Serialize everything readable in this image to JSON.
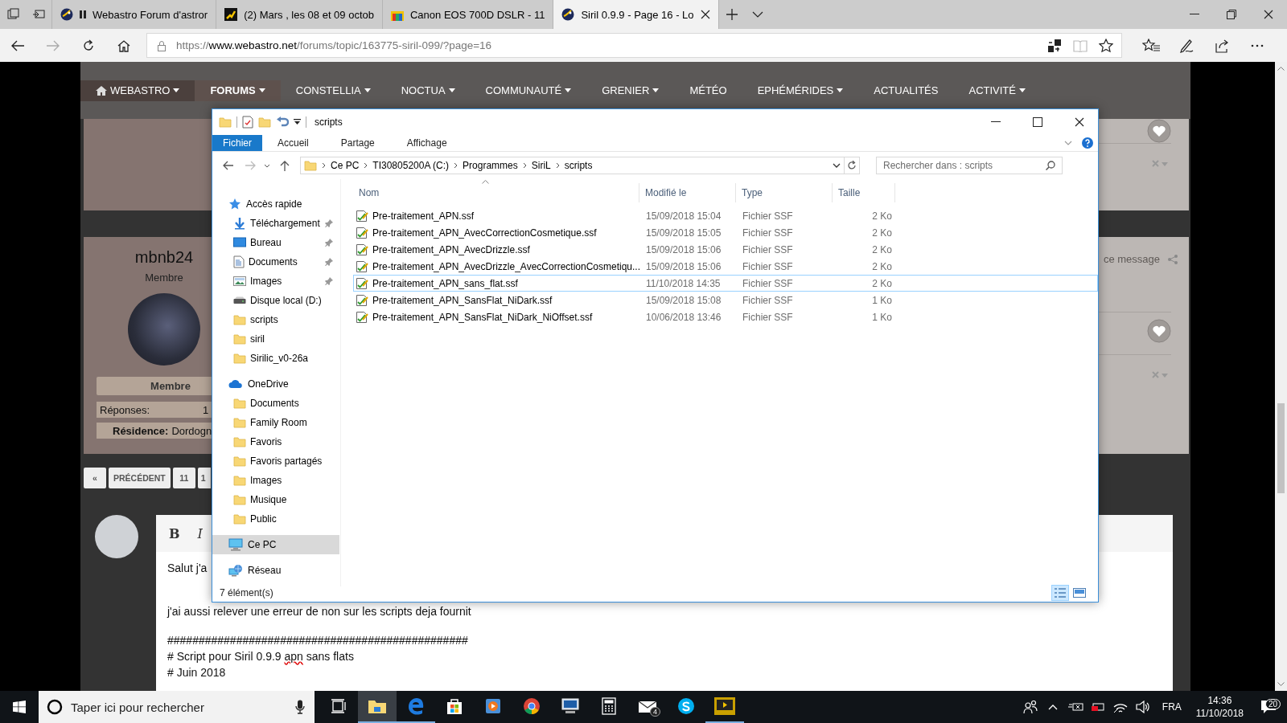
{
  "browser": {
    "tabs": [
      {
        "title": "Webastro Forum d'astror",
        "kind": "astro",
        "media_paused": true,
        "selected": false
      },
      {
        "title": "(2) Mars , les 08 et 09 octob",
        "kind": "runner",
        "media_paused": false,
        "selected": false
      },
      {
        "title": "Canon EOS 700D DSLR - 11",
        "kind": "store",
        "media_paused": false,
        "selected": false
      },
      {
        "title": "Siril 0.9.9 - Page 16 - Lo",
        "kind": "astro",
        "media_paused": false,
        "selected": true
      }
    ],
    "url": {
      "scheme": "https://",
      "host": "www.webastro.net",
      "path": "/forums/topic/163775-siril-099/?page=16"
    }
  },
  "site": {
    "nav": [
      {
        "label": "WEBASTRO",
        "home": true,
        "menu": true,
        "selected": false
      },
      {
        "label": "FORUMS",
        "home": false,
        "menu": true,
        "selected": true
      },
      {
        "label": "CONSTELLIA",
        "home": false,
        "menu": true,
        "selected": false
      },
      {
        "label": "NOCTUA",
        "home": false,
        "menu": true,
        "selected": false
      },
      {
        "label": "COMMUNAUTÉ",
        "home": false,
        "menu": true,
        "selected": false
      },
      {
        "label": "GRENIER",
        "home": false,
        "menu": true,
        "selected": false
      },
      {
        "label": "MÉTÉO",
        "home": false,
        "menu": false,
        "selected": false
      },
      {
        "label": "EPHÉMÉRIDES",
        "home": false,
        "menu": true,
        "selected": false
      },
      {
        "label": "ACTUALITÉS",
        "home": false,
        "menu": false,
        "selected": false
      },
      {
        "label": "ACTIVITÉ",
        "home": false,
        "menu": true,
        "selected": false
      }
    ],
    "post": {
      "author": "mbnb24",
      "rank": "Membre",
      "group": "Membre",
      "replies_label": "Réponses:",
      "replies": "1",
      "residence_label": "Résidence:",
      "residence": "Dordogn",
      "share_text": "ce message"
    },
    "pagination": [
      {
        "label": "«"
      },
      {
        "label": "PRÉCÉDENT"
      },
      {
        "label": "11"
      },
      {
        "label": "1"
      }
    ],
    "editor": {
      "toolbar": [
        {
          "label": "B",
          "kind": "bold"
        },
        {
          "label": "I",
          "kind": "italic"
        }
      ],
      "paragraphs": [
        [
          [
            {
              "text": "Salut j'a",
              "misspelled": false
            }
          ]
        ],
        [
          [
            {
              "text": "j'ai aussi relever une erreur de non sur les scripts deja fournit",
              "misspelled": false
            }
          ]
        ],
        [
          [
            {
              "text": "################################################",
              "misspelled": false
            }
          ],
          [
            {
              "text": "# Script pour Siril 0.9.9 ",
              "misspelled": false
            },
            {
              "text": "apn",
              "misspelled": true
            },
            {
              "text": " sans flats",
              "misspelled": false
            }
          ],
          [
            {
              "text": "# Juin 2018",
              "misspelled": false
            }
          ]
        ]
      ]
    }
  },
  "explorer": {
    "title": "scripts",
    "ribbon_tabs": [
      {
        "label": "Fichier",
        "selected": true
      },
      {
        "label": "Accueil",
        "selected": false
      },
      {
        "label": "Partage",
        "selected": false
      },
      {
        "label": "Affichage",
        "selected": false
      }
    ],
    "breadcrumb": [
      "Ce PC",
      "TI30805200A (C:)",
      "Programmes",
      "SiriL",
      "scripts"
    ],
    "search_placeholder": "Rechercher dans : scripts",
    "tree": [
      {
        "label": "Accès rapide",
        "kind": "star",
        "selected": false,
        "children": [
          {
            "label": "Téléchargement",
            "kind": "download",
            "pinned": true,
            "selected": false
          },
          {
            "label": "Bureau",
            "kind": "desktop",
            "pinned": true,
            "selected": false
          },
          {
            "label": "Documents",
            "kind": "documents",
            "pinned": true,
            "selected": false
          },
          {
            "label": "Images",
            "kind": "pictures",
            "pinned": true,
            "selected": false
          },
          {
            "label": "Disque local (D:)",
            "kind": "drive",
            "pinned": false,
            "selected": false
          },
          {
            "label": "scripts",
            "kind": "folder",
            "pinned": false,
            "selected": false
          },
          {
            "label": "siril",
            "kind": "folder",
            "pinned": false,
            "selected": false
          },
          {
            "label": "Sirilic_v0-26a",
            "kind": "folder",
            "pinned": false,
            "selected": false
          }
        ]
      },
      {
        "label": "OneDrive",
        "kind": "cloud",
        "selected": false,
        "children": [
          {
            "label": "Documents",
            "kind": "folder",
            "selected": false
          },
          {
            "label": "Family Room",
            "kind": "folder",
            "selected": false
          },
          {
            "label": "Favoris",
            "kind": "folder",
            "selected": false
          },
          {
            "label": "Favoris partagés",
            "kind": "folder",
            "selected": false
          },
          {
            "label": "Images",
            "kind": "folder",
            "selected": false
          },
          {
            "label": "Musique",
            "kind": "folder",
            "selected": false
          },
          {
            "label": "Public",
            "kind": "folder",
            "selected": false
          }
        ]
      },
      {
        "label": "Ce PC",
        "kind": "pc",
        "selected": true
      },
      {
        "label": "Réseau",
        "kind": "network",
        "selected": false
      }
    ],
    "columns": [
      "Nom",
      "Modifié le",
      "Type",
      "Taille"
    ],
    "files": [
      {
        "name": "Pre-traitement_APN.ssf",
        "modified": "15/09/2018 15:04",
        "type": "Fichier SSF",
        "size": "2 Ko",
        "selected": false
      },
      {
        "name": "Pre-traitement_APN_AvecCorrectionCosmetique.ssf",
        "modified": "15/09/2018 15:05",
        "type": "Fichier SSF",
        "size": "2 Ko",
        "selected": false
      },
      {
        "name": "Pre-traitement_APN_AvecDrizzle.ssf",
        "modified": "15/09/2018 15:06",
        "type": "Fichier SSF",
        "size": "2 Ko",
        "selected": false
      },
      {
        "name": "Pre-traitement_APN_AvecDrizzle_AvecCorrectionCosmetiqu...",
        "modified": "15/09/2018 15:06",
        "type": "Fichier SSF",
        "size": "2 Ko",
        "selected": false
      },
      {
        "name": "Pre-traitement_APN_sans_flat.ssf",
        "modified": "11/10/2018 14:35",
        "type": "Fichier SSF",
        "size": "2 Ko",
        "selected": true
      },
      {
        "name": "Pre-traitement_APN_SansFlat_NiDark.ssf",
        "modified": "15/09/2018 15:08",
        "type": "Fichier SSF",
        "size": "1 Ko",
        "selected": false
      },
      {
        "name": "Pre-traitement_APN_SansFlat_NiDark_NiOffset.ssf",
        "modified": "10/06/2018 13:46",
        "type": "Fichier SSF",
        "size": "1 Ko",
        "selected": false
      }
    ],
    "status": "7 élément(s)",
    "views": [
      {
        "kind": "details",
        "selected": true
      },
      {
        "kind": "large-icons",
        "selected": false
      }
    ]
  },
  "taskbar": {
    "search_placeholder": "Taper ici pour rechercher",
    "apps": [
      {
        "kind": "task-view",
        "open": false,
        "focused": false
      },
      {
        "kind": "folder",
        "open": true,
        "focused": true
      },
      {
        "kind": "edge",
        "open": true,
        "focused": false
      },
      {
        "kind": "store",
        "open": false,
        "focused": false
      },
      {
        "kind": "media",
        "open": false,
        "focused": false
      },
      {
        "kind": "chrome",
        "open": false,
        "focused": false
      },
      {
        "kind": "remote",
        "open": false,
        "focused": false
      },
      {
        "kind": "calculator",
        "open": false,
        "focused": false
      },
      {
        "kind": "mail",
        "open": false,
        "focused": false,
        "badge": "4"
      },
      {
        "kind": "skype",
        "open": false,
        "focused": false
      },
      {
        "kind": "player",
        "open": true,
        "focused": false
      }
    ],
    "language": "FRA",
    "time": "14:36",
    "date": "11/10/2018",
    "notifications": "20"
  }
}
